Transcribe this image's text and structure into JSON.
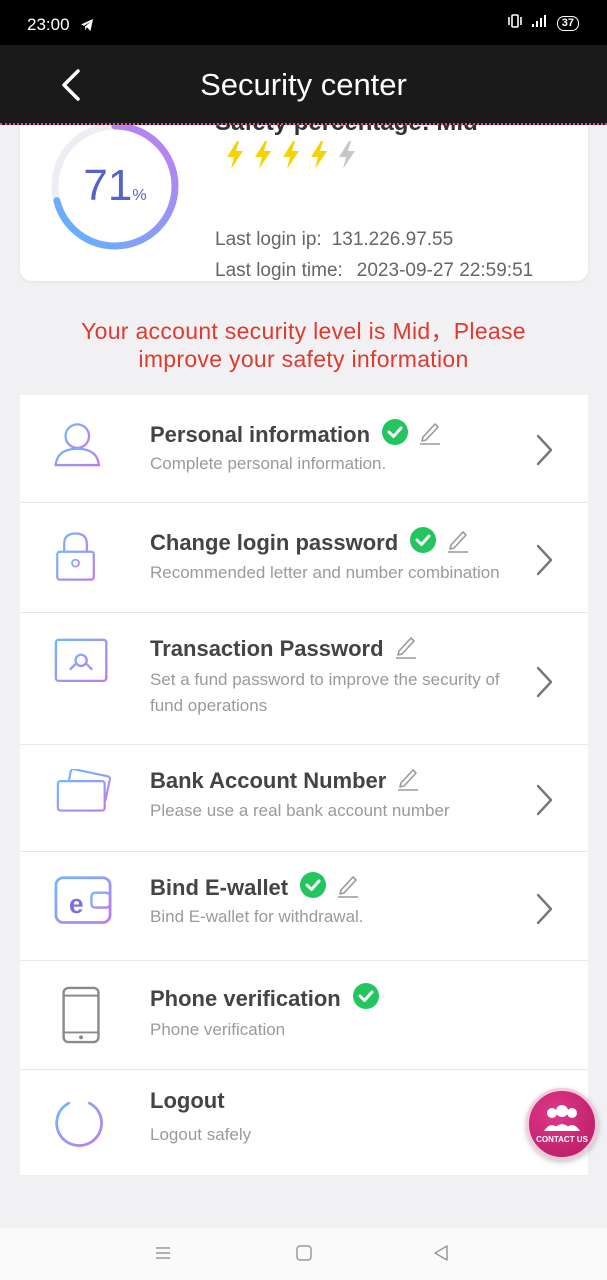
{
  "status_bar": {
    "time": "23:00",
    "battery": "37",
    "icons": [
      "telegram-icon",
      "vibrate-icon",
      "signal-icon",
      "battery-icon"
    ]
  },
  "header": {
    "title": "Security center",
    "back_icon": "chevron-left-icon"
  },
  "summary": {
    "percent": "71",
    "percent_sign": "%",
    "gauge_level": 0.71,
    "safety_label": "Safety percentage: Mid",
    "bolts_active": 4,
    "bolts_total": 5,
    "last_login_ip_label": "Last login ip:",
    "last_login_ip": "131.226.97.55",
    "last_login_time_label": "Last login time:",
    "last_login_time": "2023-09-27 22:59:51"
  },
  "warning": {
    "line1": "Your account security level is Mid，Please",
    "line2": "improve your safety information"
  },
  "menu": [
    {
      "title": "Personal information",
      "subtitle": "Complete personal information.",
      "icon": "user-icon",
      "verified": true,
      "editable": true
    },
    {
      "title": "Change login password",
      "subtitle": "Recommended letter and number combination",
      "icon": "lock-icon",
      "verified": true,
      "editable": true
    },
    {
      "title": "Transaction Password",
      "subtitle": "Set a fund password to improve the security of fund operations",
      "icon": "safe-icon",
      "verified": false,
      "editable": true
    },
    {
      "title": "Bank Account Number",
      "subtitle": "Please use a real bank account number",
      "icon": "bank-card-icon",
      "verified": false,
      "editable": true
    },
    {
      "title": "Bind E-wallet",
      "subtitle": "Bind E-wallet for withdrawal.",
      "icon": "wallet-icon",
      "verified": true,
      "editable": true
    },
    {
      "title": "Phone verification",
      "subtitle": "Phone verification",
      "icon": "phone-icon",
      "verified": true,
      "editable": false
    },
    {
      "title": "Logout",
      "subtitle": "Logout safely",
      "icon": "power-icon",
      "verified": false,
      "editable": false
    }
  ],
  "contact": {
    "label": "CONTACT US"
  },
  "colors": {
    "accent": "#5563c6",
    "warning": "#e03a2f",
    "check": "#22c55e",
    "bolt": "#f5d300",
    "header_bg": "#1a1a1a"
  }
}
